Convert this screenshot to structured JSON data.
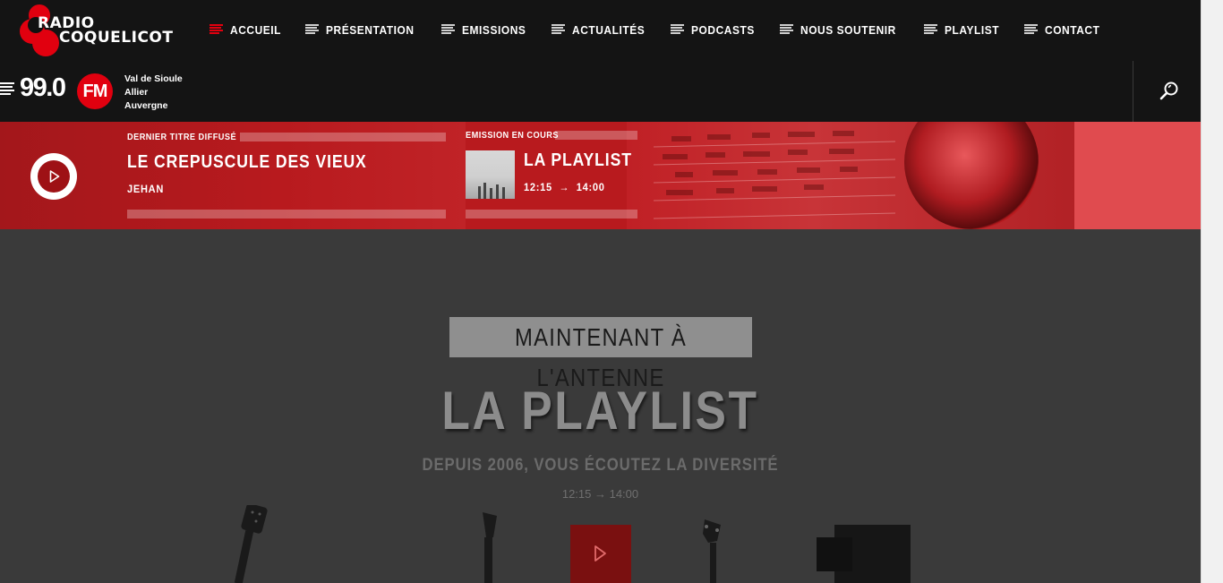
{
  "brand": {
    "name_line1": "RADIO",
    "name_line2": "COQUELICOT",
    "frequency": "99.0",
    "band": "FM",
    "region_lines": [
      "Val de Sioule",
      "Allier",
      "Auvergne"
    ],
    "accent_color": "#e1000f"
  },
  "nav": {
    "items": [
      {
        "label": "ACCUEIL",
        "active": true
      },
      {
        "label": "PRÉSENTATION",
        "active": false
      },
      {
        "label": "EMISSIONS",
        "active": false
      },
      {
        "label": "ACTUALITÉS",
        "active": false
      },
      {
        "label": "PODCASTS",
        "active": false
      },
      {
        "label": "NOUS SOUTENIR",
        "active": false
      },
      {
        "label": "PLAYLIST",
        "active": false
      },
      {
        "label": "CONTACT",
        "active": false
      }
    ],
    "search_icon": "search-icon"
  },
  "now_playing": {
    "last_track_kicker": "DERNIER TITRE DIFFUSÉ",
    "last_track_title": "LE CREPUSCULE DES VIEUX",
    "last_track_artist": "JEHAN",
    "current_show_kicker": "EMISSION EN COURS",
    "current_show_title": "LA PLAYLIST",
    "current_show_start": "12:15",
    "current_show_end": "14:00",
    "time_arrow": "→"
  },
  "hero": {
    "badge": "MAINTENANT À L'ANTENNE",
    "title": "LA PLAYLIST",
    "subtitle": "DEPUIS 2006, VOUS ÉCOUTEZ LA DIVERSITÉ",
    "schedule": "12:15 → 14:00",
    "play_icon": "play-icon"
  }
}
